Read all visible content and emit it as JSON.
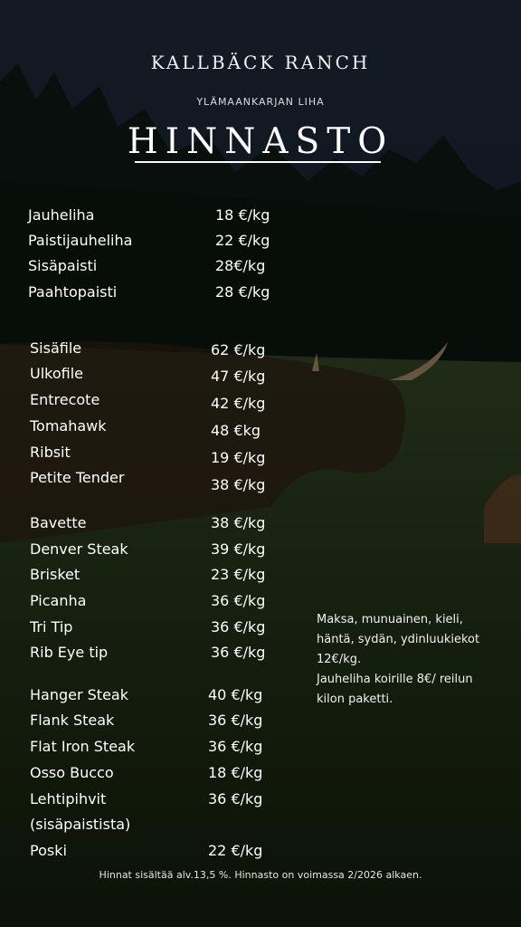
{
  "header": {
    "brand": "KALLBÄCK RANCH",
    "subtitle": "YLÄMAANKARJAN LIHA",
    "title": "HINNASTO"
  },
  "price_groups": [
    [
      {
        "name": "Jauheliha",
        "price": "18 €/kg"
      },
      {
        "name": "Paistijauheliha",
        "price": "22 €/kg"
      },
      {
        "name": "Sisäpaisti",
        "price": "28€/kg"
      },
      {
        "name": "Paahtopaisti",
        "price": "28 €/kg"
      }
    ],
    [
      {
        "name": "Sisäfile",
        "price": "62 €/kg"
      },
      {
        "name": "Ulkofile",
        "price": "47 €/kg"
      },
      {
        "name": "Entrecote",
        "price": "42 €/kg"
      },
      {
        "name": "Tomahawk",
        "price": "48 €kg"
      },
      {
        "name": "Ribsit",
        "price": "19 €/kg"
      },
      {
        "name": "Petite Tender",
        "price": "38 €/kg"
      }
    ],
    [
      {
        "name": "Bavette",
        "price": "38 €/kg"
      },
      {
        "name": "Denver Steak",
        "price": "39 €/kg"
      },
      {
        "name": "Brisket",
        "price": "23 €/kg"
      },
      {
        "name": "Picanha",
        "price": "36 €/kg"
      },
      {
        "name": "Tri Tip",
        "price": "36 €/kg"
      },
      {
        "name": "Rib Eye tip",
        "price": "36 €/kg"
      }
    ],
    [
      {
        "name": "Hanger Steak",
        "price": "40 €/kg"
      },
      {
        "name": "Flank Steak",
        "price": "36 €/kg"
      },
      {
        "name": "Flat Iron Steak",
        "price": "36 €/kg"
      },
      {
        "name": "Osso Bucco",
        "price": "18 €/kg"
      },
      {
        "name": "Lehtipihvit",
        "price": "36 €/kg"
      },
      {
        "name": "(sisäpaistista)",
        "price": ""
      },
      {
        "name": "Poski",
        "price": "22 €/kg"
      }
    ]
  ],
  "note": {
    "line1": "Maksa, munuainen, kieli,",
    "line2": "häntä, sydän, ydinluukiekot",
    "line3": "12€/kg.",
    "line4": "Jauheliha koirille 8€/ reilun",
    "line5": "kilon paketti."
  },
  "footer": "Hinnat sisältää alv.13,5 %. Hinnasto on voimassa 2/2026 alkaen."
}
